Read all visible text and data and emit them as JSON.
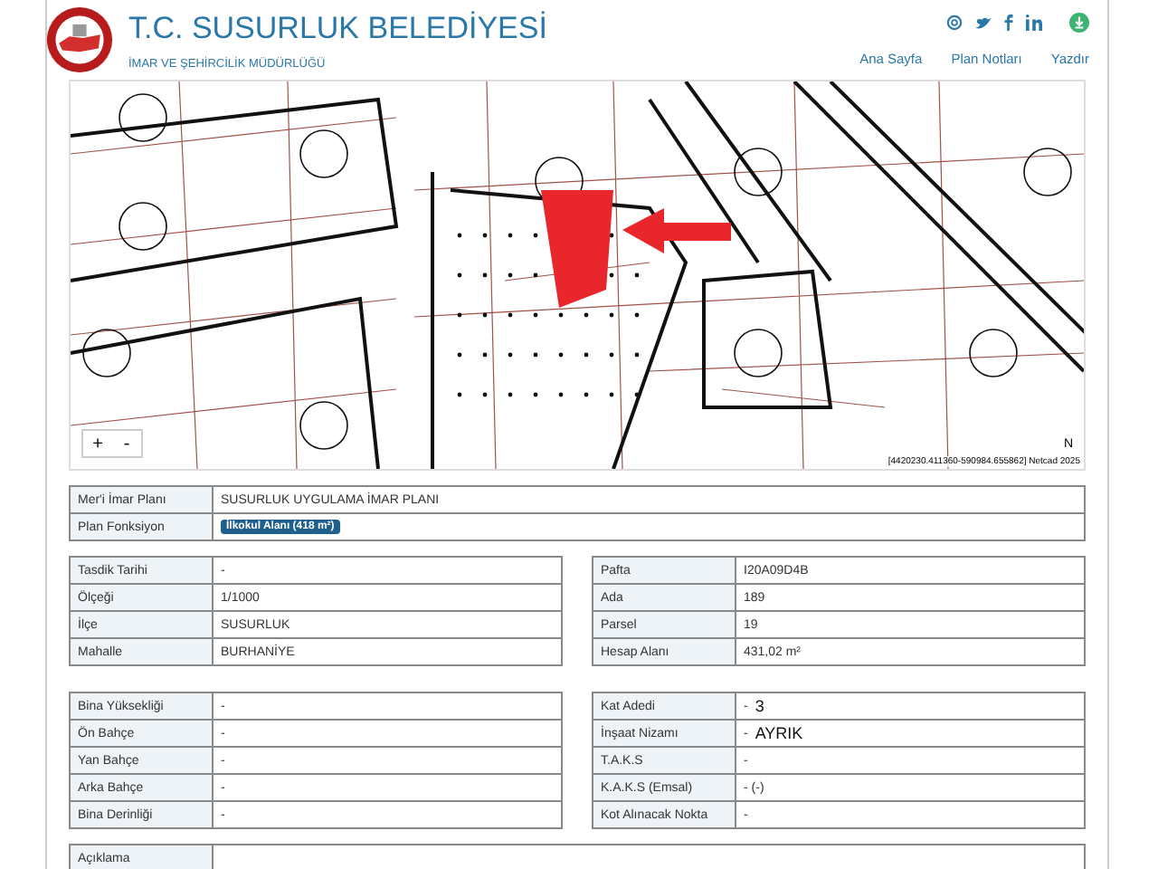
{
  "header": {
    "title": "T.C. SUSURLUK BELEDİYESİ",
    "subtitle": "İMAR VE ŞEHİRCİLİK MÜDÜRLÜĞÜ",
    "nav": [
      "Ana Sayfa",
      "Plan Notları",
      "Yazdır"
    ]
  },
  "map": {
    "zoom_in": "+",
    "zoom_out": "-",
    "north": "N",
    "attribution": "[4420230.411360-590984.655862] Netcad 2025"
  },
  "plan_table": [
    {
      "label": "Mer'i İmar Planı",
      "value": "SUSURLUK UYGULAMA İMAR PLANI",
      "kind": "text"
    },
    {
      "label": "Plan Fonksiyon",
      "value": "İlkokul Alanı (418 m²)",
      "kind": "tag"
    }
  ],
  "left_table": [
    {
      "label": "Tasdik Tarihi",
      "value": "-"
    },
    {
      "label": "Ölçeği",
      "value": "1/1000"
    },
    {
      "label": "İlçe",
      "value": "SUSURLUK"
    },
    {
      "label": "Mahalle",
      "value": "BURHANİYE"
    }
  ],
  "right_table": [
    {
      "label": "Pafta",
      "value": "I20A09D4B"
    },
    {
      "label": "Ada",
      "value": "189"
    },
    {
      "label": "Parsel",
      "value": "19"
    },
    {
      "label": "Hesap Alanı",
      "value": "431,02 m²"
    }
  ],
  "left_table_2": [
    {
      "label": "Bina Yüksekliği",
      "value": "-"
    },
    {
      "label": "Ön Bahçe",
      "value": "-"
    },
    {
      "label": "Yan Bahçe",
      "value": "-"
    },
    {
      "label": "Arka Bahçe",
      "value": "-"
    },
    {
      "label": "Bina Derinliği",
      "value": "-"
    }
  ],
  "right_table_2": [
    {
      "label": "Kat Adedi",
      "value": "-",
      "note": "3"
    },
    {
      "label": "İnşaat Nizamı",
      "value": "-",
      "note": "AYRIK"
    },
    {
      "label": "T.A.K.S",
      "value": "-"
    },
    {
      "label": "K.A.K.S (Emsal)",
      "value": "- (-)"
    },
    {
      "label": "Kot Alınacak Nokta",
      "value": "-"
    }
  ],
  "notes_table": [
    {
      "label": "Açıklama"
    }
  ]
}
